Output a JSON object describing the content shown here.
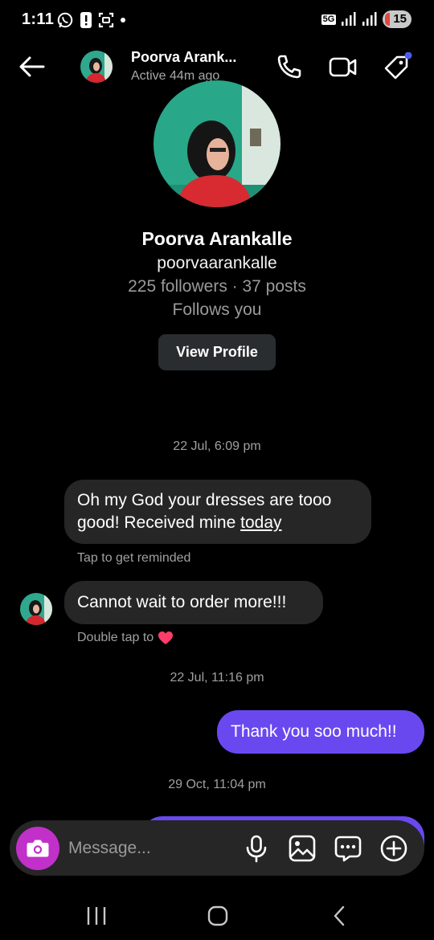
{
  "status_bar": {
    "time": "1:11",
    "network_label": "5G",
    "battery": "15"
  },
  "header": {
    "name": "Poorva Arank...",
    "status": "Active 44m ago"
  },
  "profile": {
    "name": "Poorva Arankalle",
    "handle": "poorvaarankalle",
    "stats": "225 followers · 37 posts",
    "follows": "Follows you",
    "view_button": "View Profile"
  },
  "thread": {
    "timestamp_1": "22 Jul, 6:09 pm",
    "msg_1_text": "Oh my God your dresses are tooo good! Received mine ",
    "msg_1_link": "today",
    "hint_1": "Tap to get reminded",
    "msg_2_text": "Cannot wait to order more!!!",
    "hint_2": "Double tap to",
    "timestamp_2": "22 Jul, 11:16 pm",
    "msg_3_text": "Thank you soo much!!",
    "timestamp_3": "29 Oct, 11:04 pm"
  },
  "composer": {
    "placeholder": "Message..."
  },
  "colors": {
    "accent": "#6a48f0",
    "camera": "#c130c8",
    "incoming_bubble": "#262626",
    "notification_dot": "#4a5cf0",
    "heart": "#ff3d6a"
  },
  "icons": {
    "back": "arrow-left-icon",
    "call": "phone-icon",
    "video": "video-camera-icon",
    "tag": "tag-icon",
    "camera": "camera-icon",
    "mic": "microphone-icon",
    "gallery": "image-icon",
    "sticker": "chat-bubble-icon",
    "add": "plus-circle-icon"
  }
}
